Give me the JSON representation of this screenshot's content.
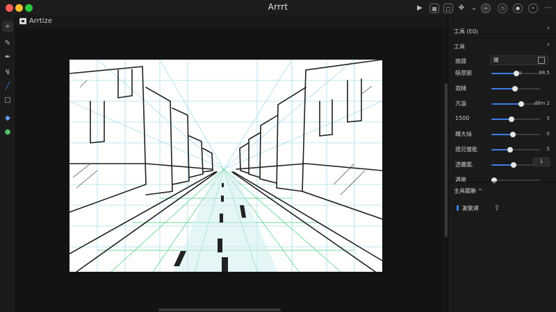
{
  "window": {
    "title": "Arrrt"
  },
  "document": {
    "tab_label": "Arrtize"
  },
  "panel": {
    "title": "工具 (E0)",
    "subtitle": "工具",
    "field_label": "擦鏢",
    "field_value": "鐲",
    "rows": [
      {
        "label": "帳厚腿",
        "value": "88.5",
        "pct": 0.52,
        "prefix": "s"
      },
      {
        "label": "哉精",
        "value": "",
        "pct": 0.48,
        "prefix": ""
      },
      {
        "label": "亢漩",
        "value": "dfim 2",
        "pct": 0.62,
        "prefix": ""
      },
      {
        "label": "1500",
        "value": "5",
        "pct": 0.42,
        "prefix": ""
      },
      {
        "label": "鐵大絲",
        "value": "0",
        "pct": 0.44,
        "prefix": ""
      },
      {
        "label": "擔兄徹能",
        "value": "5",
        "pct": 0.38,
        "prefix": ""
      },
      {
        "label": "透攤鑑.",
        "value": "",
        "pct": 0.46,
        "prefix": ""
      },
      {
        "label": "邁撤",
        "value": "",
        "pct": 0.05,
        "prefix": ""
      }
    ],
    "stepper_value": "1",
    "section2_title": "主具關聯 ^",
    "layer_name": "謝繁膚"
  },
  "colors": {
    "accent": "#3b7ee8",
    "close": "#ff5f57",
    "minimize": "#febc2e",
    "zoom": "#28c840"
  }
}
